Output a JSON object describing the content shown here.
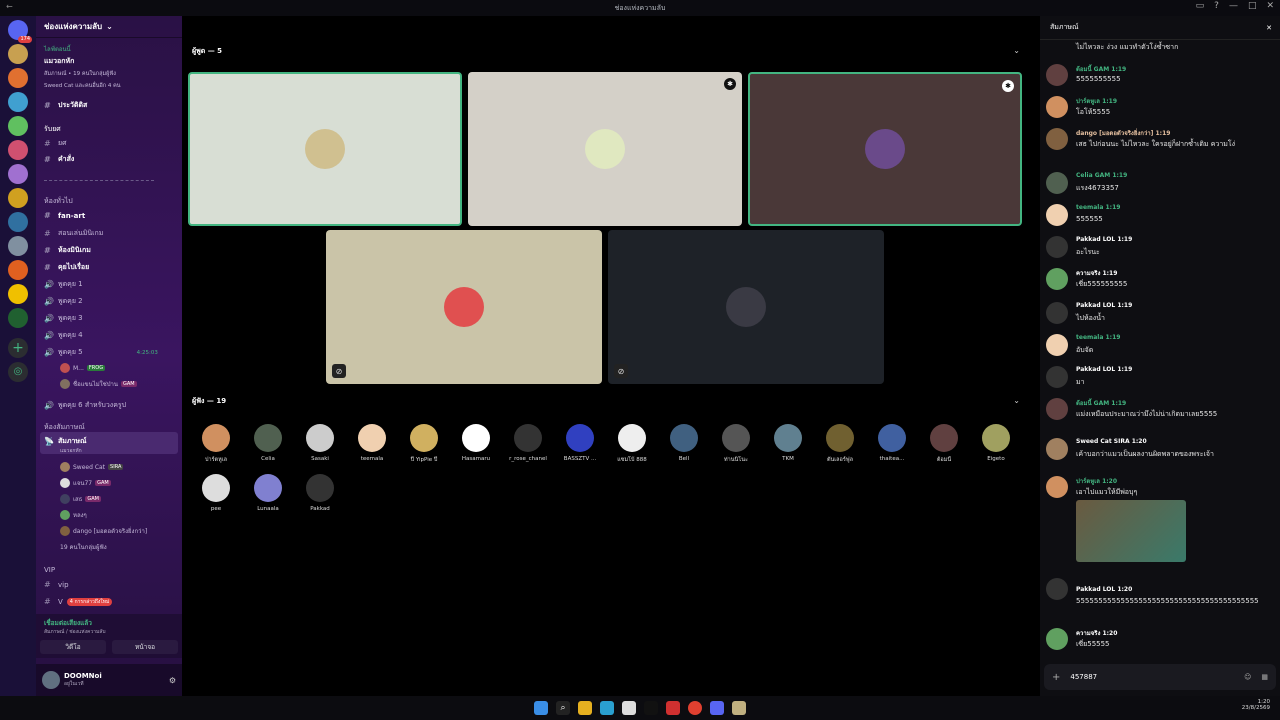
{
  "window": {
    "title": "ช่องแห่งความลับ"
  },
  "server": {
    "name": "ช่องแห่งความลับ"
  },
  "event": {
    "label": "ไลฟ์ตอนนี้",
    "title": "แมวอกหัก",
    "sub1": "สัมภาษณ์ • 19 คนในกลุ่มผู้ฟัง",
    "sub2": "Sweed Cat และคนอื่นอีก 4 คน"
  },
  "channels": {
    "history": "ประวัติดิส",
    "cat_rules": "รับยศ",
    "ch_yos": "ยศ",
    "ch_command": "คำสั่ง",
    "cat_general": "ห้องทั่วไป",
    "fanart": "fan-art",
    "play": "สอนเล่นมินิเกม",
    "minigame": "ห้องมินิเกม",
    "chat": "คุยไปเรื่อย",
    "talk1": "พูดคุย 1",
    "talk2": "พูดคุย 2",
    "talk3": "พูดคุย 3",
    "talk4": "พูดคุย 4",
    "talk5": "พูดคุย 5",
    "talk5_time": "4:25:03",
    "talk5_u1": "M...",
    "talk5_u1_tag": "FROG",
    "talk5_u2": "ชื่อแขนไม่ใช่ป่าน",
    "talk5_u2_tag": "GAM",
    "talk6": "พูดคุย 6 สำหรับวงครูป",
    "cat_stage": "ห้องสัมภาษณ์",
    "stage": "สัมภาษณ์",
    "stage_sub": "แมวอกหัก",
    "s1": "Sweed Cat",
    "s1_tag": "SIRA",
    "s2": "แจน77",
    "s2_tag": "GAM",
    "s3": "เสธ",
    "s3_tag": "GAM",
    "s4": "หลงๆ",
    "s5": "dango [มอดอตัวจริงยิ่งกว่า]",
    "s6": "19 คนในกลุ่มผู้ฟัง",
    "cat_vip": "VIP",
    "vip": "vip",
    "vip2": "V",
    "vip_badge": "4 การกล่าวถึงใหม่"
  },
  "voice": {
    "status": "เชื่อมต่อเสียงแล้ว",
    "where": "สัมภาษณ์ / ช่องแห่งความลับ",
    "video": "วิดีโอ",
    "screen": "หน้าจอ"
  },
  "user": {
    "name": "DOOMNoi",
    "status": "อยู่ในเวที"
  },
  "stage": {
    "speakers_label": "ผู้พูด — 5",
    "audience_label": "ผู้ฟัง — 19",
    "audience": [
      "ปาร์ตหูเล",
      "Celia",
      "Sasaki",
      "teemala",
      "ปี YipPie ปี",
      "Hasamaru",
      "r_rose_chanel",
      "BASSZTV ...",
      "แซมโบ้ 888",
      "Bell",
      "ท่านนิโนะ",
      "TKM",
      "ตันเลอร์ฟูล",
      "thaitea...",
      "ต้อมนี้",
      "Eigeto",
      "pee",
      "Lunaala",
      "Pakkad"
    ]
  },
  "chat": {
    "header": "สัมภาษณ์",
    "top_text": "ไม่ไหวละ ง่วง แมวทำตัวโง่ซ้ำซาก",
    "messages": [
      {
        "name": "ต้อมนี้ GAM 1:19",
        "text": "5555555555"
      },
      {
        "name": "ปาร์ตหูเล 1:19",
        "text": "โอโห้5555"
      },
      {
        "name": "dango [มอดอตัวจริงยิ่งกว่า] 1:19",
        "text": "เสธ ไปก่อนนะ ไม่ไหวละ ใครอยู่ก็ฝากซ้ำเติม ความโง่"
      },
      {
        "name": "Celia GAM 1:19",
        "text": "แรง4673357"
      },
      {
        "name": "teemala 1:19",
        "text": "555555"
      },
      {
        "name": "Pakkad LOL 1:19",
        "text": "อะไรนะ"
      },
      {
        "name": "ความจริง 1:19",
        "text": "เชี่ย555555555"
      },
      {
        "name": "Pakkad LOL 1:19",
        "text": "ไปห้องน้ำ"
      },
      {
        "name": "teemala 1:19",
        "text": "อับจัด"
      },
      {
        "name": "Pakkad LOL 1:19",
        "text": "มา"
      },
      {
        "name": "ต้อมนี้ GAM 1:19",
        "text": "แม่งเหมือนประมาณว่ามึงไม่น่าเกิดมาเลย5555"
      },
      {
        "name": "Sweed Cat SIRA 1:20",
        "text": "เค้าบอกว่าแมวเป็นผลงานผิดพลาดของพระเจ้า"
      },
      {
        "name": "ปาร์ตหูเล 1:20",
        "text": "เอาไปแมวให้มีพ่อบุๆ"
      },
      {
        "name": "Pakkad LOL 1:20",
        "text": "55555555555555555555555555555555555555555"
      },
      {
        "name": "ความจริง 1:20",
        "text": "เซี่ย55555"
      }
    ],
    "input_value": "457887"
  },
  "taskbar": {
    "time": "1:20",
    "date": "23/8/2569"
  },
  "colors": {
    "accent": "#43b581",
    "bg": "#000000"
  }
}
